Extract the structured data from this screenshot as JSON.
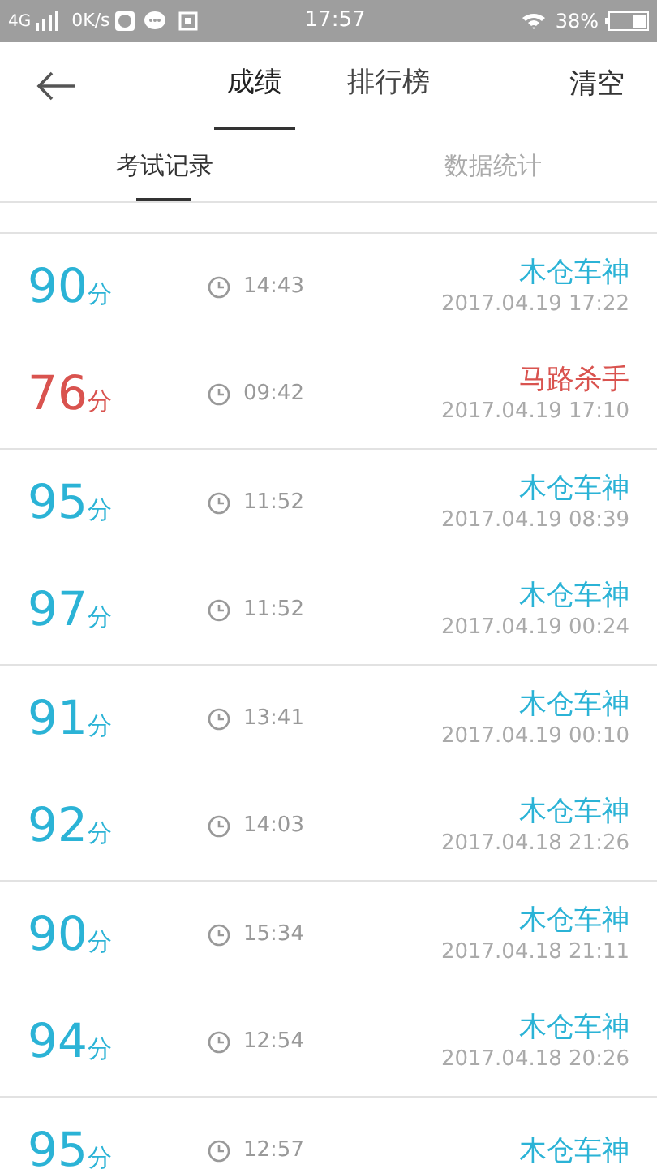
{
  "status_bar": {
    "network": "4G",
    "speed": "0K/s",
    "time": "17:57",
    "battery_text": "38%"
  },
  "header": {
    "tabs": [
      {
        "label": "成绩",
        "selected": true
      },
      {
        "label": "排行榜",
        "selected": false
      }
    ],
    "action": "清空"
  },
  "sub_tabs": [
    {
      "label": "考试记录",
      "selected": true
    },
    {
      "label": "数据统计",
      "selected": false
    }
  ],
  "groups": [
    {
      "rows": [
        {
          "score": "90",
          "unit": "分",
          "duration": "14:43",
          "name": "木仓车神",
          "date": "2017.04.19 17:22",
          "kind": "pass"
        },
        {
          "score": "76",
          "unit": "分",
          "duration": "09:42",
          "name": "马路杀手",
          "date": "2017.04.19 17:10",
          "kind": "fail"
        }
      ]
    },
    {
      "rows": [
        {
          "score": "95",
          "unit": "分",
          "duration": "11:52",
          "name": "木仓车神",
          "date": "2017.04.19 08:39",
          "kind": "pass"
        },
        {
          "score": "97",
          "unit": "分",
          "duration": "11:52",
          "name": "木仓车神",
          "date": "2017.04.19 00:24",
          "kind": "pass"
        }
      ]
    },
    {
      "rows": [
        {
          "score": "91",
          "unit": "分",
          "duration": "13:41",
          "name": "木仓车神",
          "date": "2017.04.19 00:10",
          "kind": "pass"
        },
        {
          "score": "92",
          "unit": "分",
          "duration": "14:03",
          "name": "木仓车神",
          "date": "2017.04.18 21:26",
          "kind": "pass"
        }
      ]
    },
    {
      "rows": [
        {
          "score": "90",
          "unit": "分",
          "duration": "15:34",
          "name": "木仓车神",
          "date": "2017.04.18 21:11",
          "kind": "pass"
        },
        {
          "score": "94",
          "unit": "分",
          "duration": "12:54",
          "name": "木仓车神",
          "date": "2017.04.18 20:26",
          "kind": "pass"
        }
      ]
    },
    {
      "rows": [
        {
          "score": "95",
          "unit": "分",
          "duration": "12:57",
          "name": "木仓车神",
          "kind": "pass"
        }
      ]
    }
  ]
}
